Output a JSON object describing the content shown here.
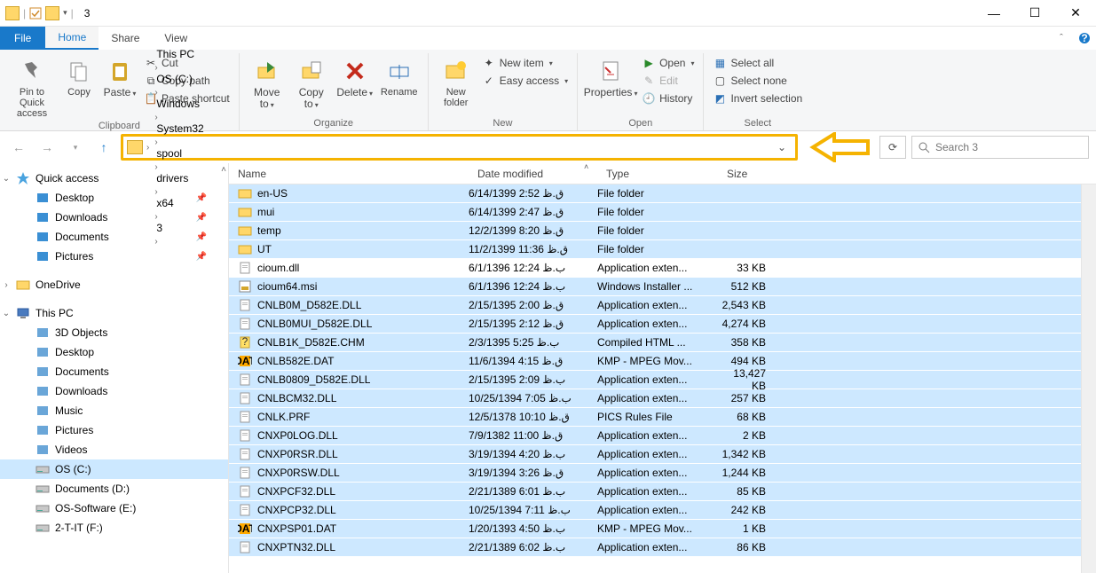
{
  "window": {
    "title": "3",
    "qat_items": [
      "folder",
      "properties",
      "folder"
    ]
  },
  "tabs": {
    "file": "File",
    "items": [
      "Home",
      "Share",
      "View"
    ],
    "active": 0
  },
  "ribbon": {
    "clipboard": {
      "label": "Clipboard",
      "pin": "Pin to Quick access",
      "copy": "Copy",
      "paste": "Paste",
      "cut": "Cut",
      "copypath": "Copy path",
      "pasteshortcut": "Paste shortcut"
    },
    "organize": {
      "label": "Organize",
      "moveto": "Move to",
      "copyto": "Copy to",
      "delete": "Delete",
      "rename": "Rename"
    },
    "new": {
      "label": "New",
      "newfolder": "New folder",
      "newitem": "New item",
      "easyaccess": "Easy access"
    },
    "open": {
      "label": "Open",
      "properties": "Properties",
      "open": "Open",
      "edit": "Edit",
      "history": "History"
    },
    "select": {
      "label": "Select",
      "selectall": "Select all",
      "selectnone": "Select none",
      "invert": "Invert selection"
    }
  },
  "breadcrumb": [
    "This PC",
    "OS (C:)",
    "Windows",
    "System32",
    "spool",
    "drivers",
    "x64",
    "3"
  ],
  "search": {
    "placeholder": "Search 3"
  },
  "nav": {
    "quick": {
      "label": "Quick access",
      "items": [
        "Desktop",
        "Downloads",
        "Documents",
        "Pictures"
      ]
    },
    "onedrive": "OneDrive",
    "thispc": {
      "label": "This PC",
      "items": [
        "3D Objects",
        "Desktop",
        "Documents",
        "Downloads",
        "Music",
        "Pictures",
        "Videos",
        "OS (C:)",
        "Documents (D:)",
        "OS-Software (E:)",
        "2-T-IT (F:)"
      ]
    }
  },
  "columns": {
    "name": "Name",
    "date": "Date modified",
    "type": "Type",
    "size": "Size"
  },
  "files": [
    {
      "icon": "folder",
      "name": "en-US",
      "date": "6/14/1399 2:52 ق.ظ",
      "type": "File folder",
      "size": "",
      "sel": true
    },
    {
      "icon": "folder",
      "name": "mui",
      "date": "6/14/1399 2:47 ق.ظ",
      "type": "File folder",
      "size": "",
      "sel": true
    },
    {
      "icon": "folder",
      "name": "temp",
      "date": "12/2/1399 8:20 ق.ظ",
      "type": "File folder",
      "size": "",
      "sel": true
    },
    {
      "icon": "folder",
      "name": "UT",
      "date": "11/2/1399 11:36 ق.ظ",
      "type": "File folder",
      "size": "",
      "sel": true
    },
    {
      "icon": "dll",
      "name": "cioum.dll",
      "date": "6/1/1396 12:24 ب.ظ",
      "type": "Application exten...",
      "size": "33 KB",
      "sel": false
    },
    {
      "icon": "msi",
      "name": "cioum64.msi",
      "date": "6/1/1396 12:24 ب.ظ",
      "type": "Windows Installer ...",
      "size": "512 KB",
      "sel": true
    },
    {
      "icon": "dll",
      "name": "CNLB0M_D582E.DLL",
      "date": "2/15/1395 2:00 ق.ظ",
      "type": "Application exten...",
      "size": "2,543 KB",
      "sel": true
    },
    {
      "icon": "dll",
      "name": "CNLB0MUI_D582E.DLL",
      "date": "2/15/1395 2:12 ق.ظ",
      "type": "Application exten...",
      "size": "4,274 KB",
      "sel": true
    },
    {
      "icon": "chm",
      "name": "CNLB1K_D582E.CHM",
      "date": "2/3/1395 5:25 ب.ظ",
      "type": "Compiled HTML ...",
      "size": "358 KB",
      "sel": true
    },
    {
      "icon": "dat",
      "name": "CNLB582E.DAT",
      "date": "11/6/1394 4:15 ق.ظ",
      "type": "KMP - MPEG Mov...",
      "size": "494 KB",
      "sel": true
    },
    {
      "icon": "dll",
      "name": "CNLB0809_D582E.DLL",
      "date": "2/15/1395 2:09 ب.ظ",
      "type": "Application exten...",
      "size": "13,427 KB",
      "sel": true
    },
    {
      "icon": "dll",
      "name": "CNLBCM32.DLL",
      "date": "10/25/1394 7:05 ب.ظ",
      "type": "Application exten...",
      "size": "257 KB",
      "sel": true
    },
    {
      "icon": "file",
      "name": "CNLK.PRF",
      "date": "12/5/1378 10:10 ق.ظ",
      "type": "PICS Rules File",
      "size": "68 KB",
      "sel": true
    },
    {
      "icon": "dll",
      "name": "CNXP0LOG.DLL",
      "date": "7/9/1382 11:00 ق.ظ",
      "type": "Application exten...",
      "size": "2 KB",
      "sel": true
    },
    {
      "icon": "dll",
      "name": "CNXP0RSR.DLL",
      "date": "3/19/1394 4:20 ب.ظ",
      "type": "Application exten...",
      "size": "1,342 KB",
      "sel": true
    },
    {
      "icon": "dll",
      "name": "CNXP0RSW.DLL",
      "date": "3/19/1394 3:26 ق.ظ",
      "type": "Application exten...",
      "size": "1,244 KB",
      "sel": true
    },
    {
      "icon": "dll",
      "name": "CNXPCF32.DLL",
      "date": "2/21/1389 6:01 ب.ظ",
      "type": "Application exten...",
      "size": "85 KB",
      "sel": true
    },
    {
      "icon": "dll",
      "name": "CNXPCP32.DLL",
      "date": "10/25/1394 7:11 ب.ظ",
      "type": "Application exten...",
      "size": "242 KB",
      "sel": true
    },
    {
      "icon": "dat",
      "name": "CNXPSP01.DAT",
      "date": "1/20/1393 4:50 ب.ظ",
      "type": "KMP - MPEG Mov...",
      "size": "1 KB",
      "sel": true
    },
    {
      "icon": "dll",
      "name": "CNXPTN32.DLL",
      "date": "2/21/1389 6:02 ب.ظ",
      "type": "Application exten...",
      "size": "86 KB",
      "sel": true
    }
  ]
}
